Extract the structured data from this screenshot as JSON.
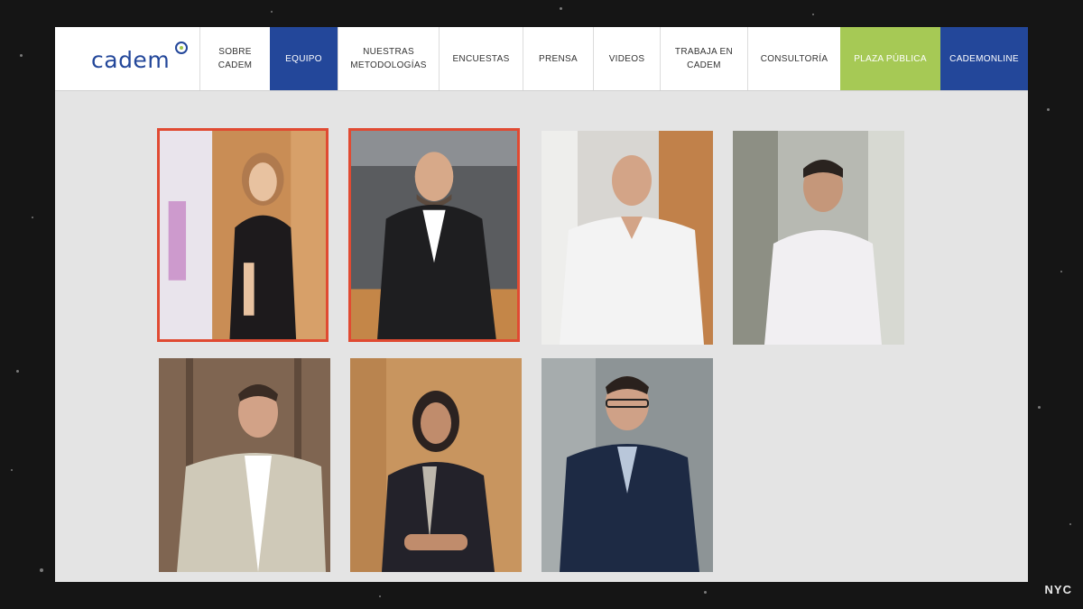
{
  "logo": {
    "text": "cadem"
  },
  "nav": {
    "items": [
      {
        "label": "SOBRE\nCADEM"
      },
      {
        "label": "EQUIPO"
      },
      {
        "label": "NUESTRAS\nMETODOLOGÍAS"
      },
      {
        "label": "ENCUESTAS"
      },
      {
        "label": "PRENSA"
      },
      {
        "label": "VIDEOS"
      },
      {
        "label": "TRABAJA EN\nCADEM"
      },
      {
        "label": "CONSULTORÍA"
      },
      {
        "label": "PLAZA PÚBLICA"
      },
      {
        "label": "CADEMONLINE"
      }
    ]
  },
  "colors": {
    "brand_blue": "#23479a",
    "accent_green": "#a6c955",
    "selection_red": "#e04a32"
  },
  "team_photos": [
    {
      "selected": true
    },
    {
      "selected": true
    },
    {
      "selected": false
    },
    {
      "selected": false
    },
    {
      "selected": false
    },
    {
      "selected": false
    },
    {
      "selected": false
    }
  ],
  "watermark": "NYC"
}
